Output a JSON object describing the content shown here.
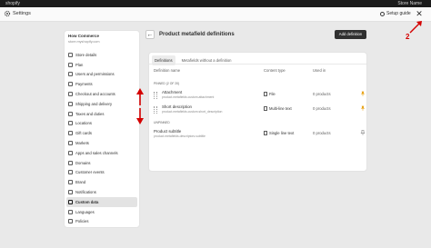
{
  "topbar": {
    "brand": "shopify",
    "user": "Store Name"
  },
  "window": {
    "title": "Settings",
    "setup_guide": "Setup guide",
    "close_symbol": "✕"
  },
  "store": {
    "name": "How Commerce",
    "url": "store.myshopify.com"
  },
  "sidebar": {
    "items": [
      {
        "label": "Store details",
        "icon": "store-icon"
      },
      {
        "label": "Plan",
        "icon": "plan-icon"
      },
      {
        "label": "Users and permissions",
        "icon": "users-icon"
      },
      {
        "label": "Payments",
        "icon": "payments-icon"
      },
      {
        "label": "Checkout and accounts",
        "icon": "checkout-icon"
      },
      {
        "label": "Shipping and delivery",
        "icon": "shipping-icon"
      },
      {
        "label": "Taxes and duties",
        "icon": "taxes-icon"
      },
      {
        "label": "Locations",
        "icon": "location-icon"
      },
      {
        "label": "Gift cards",
        "icon": "gift-card-icon"
      },
      {
        "label": "Markets",
        "icon": "markets-icon"
      },
      {
        "label": "Apps and sales channels",
        "icon": "apps-icon"
      },
      {
        "label": "Domains",
        "icon": "domains-icon"
      },
      {
        "label": "Customer events",
        "icon": "customer-events-icon"
      },
      {
        "label": "Brand",
        "icon": "brand-icon"
      },
      {
        "label": "Notifications",
        "icon": "notifications-icon"
      },
      {
        "label": "Custom data",
        "icon": "custom-data-icon",
        "active": true
      },
      {
        "label": "Languages",
        "icon": "languages-icon"
      },
      {
        "label": "Policies",
        "icon": "policies-icon"
      }
    ]
  },
  "main": {
    "back": "←",
    "title": "Product metafield definitions",
    "add_button": "Add definition",
    "tabs": [
      {
        "label": "Definitions",
        "active": true
      },
      {
        "label": "Metafields without a definition",
        "active": false
      }
    ],
    "columns": {
      "name": "Definition name",
      "type": "Content type",
      "used": "Used in"
    },
    "pinned_label": "PINNED (2 OF 20)",
    "unpinned_label": "UNPINNED",
    "pinned_rows": [
      {
        "name": "Attachment",
        "key": "product.metafields.custom.attachment",
        "type": "File",
        "type_icon": "file-icon",
        "used": "0 products"
      },
      {
        "name": "Short description",
        "key": "product.metafields.custom.short_description",
        "type": "Multi-line text",
        "type_icon": "text-icon",
        "used": "0 products"
      }
    ],
    "unpinned_rows": [
      {
        "name": "Product subtitle",
        "key": "product.metafields.descriptors.subtitle",
        "type": "Single line text",
        "type_icon": "text-icon",
        "used": "0 products"
      }
    ]
  },
  "annotation": {
    "number": "2",
    "color": "#d40000"
  },
  "colors": {
    "accent_dark": "#303030",
    "annotation_red": "#d40000",
    "pin_orange": "#e8a317"
  }
}
